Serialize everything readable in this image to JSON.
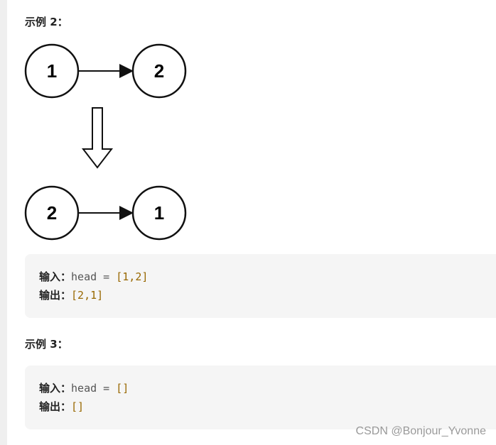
{
  "example2": {
    "title": "示例 2：",
    "before": [
      "1",
      "2"
    ],
    "after": [
      "2",
      "1"
    ],
    "input_label": "输入：",
    "input_code": "head = ",
    "input_value": "[1,2]",
    "output_label": "输出：",
    "output_value": "[2,1]"
  },
  "example3": {
    "title": "示例 3：",
    "input_label": "输入：",
    "input_code": "head = ",
    "input_value": "[]",
    "output_label": "输出：",
    "output_value": "[]"
  },
  "watermark": "CSDN @Bonjour_Yvonne"
}
